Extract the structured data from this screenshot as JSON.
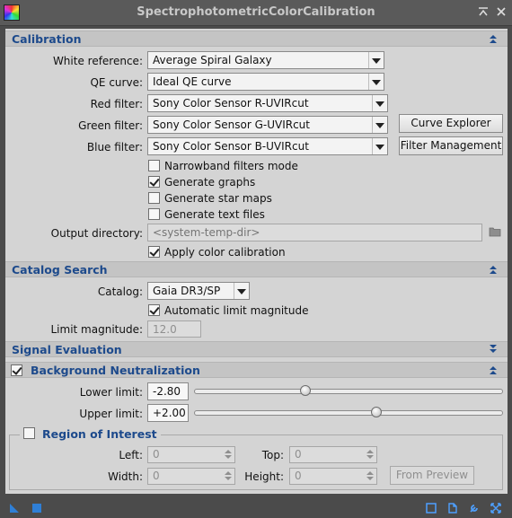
{
  "window": {
    "title": "SpectrophotometricColorCalibration"
  },
  "calibration": {
    "section_title": "Calibration",
    "white_reference": {
      "label": "White reference:",
      "value": "Average Spiral Galaxy"
    },
    "qe_curve": {
      "label": "QE curve:",
      "value": "Ideal QE curve"
    },
    "red_filter": {
      "label": "Red filter:",
      "value": "Sony Color Sensor R-UVIRcut"
    },
    "green_filter": {
      "label": "Green filter:",
      "value": "Sony Color Sensor G-UVIRcut"
    },
    "blue_filter": {
      "label": "Blue filter:",
      "value": "Sony Color Sensor B-UVIRcut"
    },
    "curve_explorer_label": "Curve Explorer",
    "filter_management_label": "Filter Management",
    "narrowband": {
      "label": "Narrowband filters mode",
      "checked": false
    },
    "generate_graphs": {
      "label": "Generate graphs",
      "checked": true
    },
    "generate_star_maps": {
      "label": "Generate star maps",
      "checked": false
    },
    "generate_text_files": {
      "label": "Generate text files",
      "checked": false
    },
    "output_directory": {
      "label": "Output directory:",
      "placeholder": "<system-temp-dir>"
    },
    "apply_color_calibration": {
      "label": "Apply color calibration",
      "checked": true
    }
  },
  "catalog_search": {
    "section_title": "Catalog Search",
    "catalog": {
      "label": "Catalog:",
      "value": "Gaia DR3/SP"
    },
    "automatic_limit": {
      "label": "Automatic limit magnitude",
      "checked": true
    },
    "limit_magnitude": {
      "label": "Limit magnitude:",
      "value": "12.0"
    }
  },
  "signal_evaluation": {
    "section_title": "Signal Evaluation"
  },
  "background_neutralization": {
    "section_title": "Background Neutralization",
    "enabled": true,
    "lower_limit": {
      "label": "Lower limit:",
      "value": "-2.80",
      "slider_fraction": 0.36
    },
    "upper_limit": {
      "label": "Upper limit:",
      "value": "+2.00",
      "slider_fraction": 0.59
    },
    "region_of_interest": {
      "title": "Region of Interest",
      "enabled": false,
      "left": {
        "label": "Left:",
        "value": "0"
      },
      "top": {
        "label": "Top:",
        "value": "0"
      },
      "width": {
        "label": "Width:",
        "value": "0"
      },
      "height": {
        "label": "Height:",
        "value": "0"
      },
      "from_preview_label": "From Preview"
    }
  },
  "icons": {
    "collapse": "double-chevron-up-icon",
    "expand": "double-chevron-down-icon",
    "folder": "folder-icon",
    "footer_left": [
      "new-instance-icon",
      "apply-global-icon"
    ],
    "footer_right": [
      "preview-icon",
      "documentation-icon",
      "settings-wrench-icon",
      "reset-icon"
    ]
  },
  "colors": {
    "section_title": "#1d4a8c",
    "panel_bg": "#d4d4d4",
    "frame_bg": "#4b4b4b"
  }
}
